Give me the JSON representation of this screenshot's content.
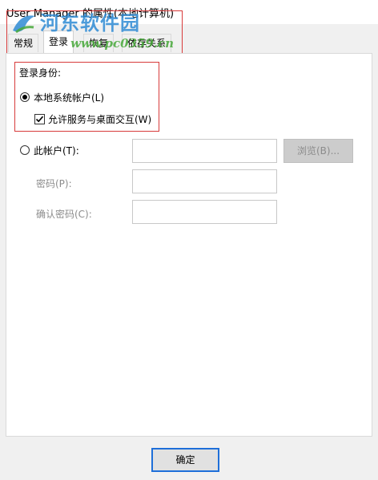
{
  "window": {
    "title": "User Manager 的属性(本地计算机)"
  },
  "watermark": {
    "site_name": "河东软件园",
    "site_url": "www.pc0359.cn"
  },
  "tabs": [
    {
      "label": "常规",
      "active": false
    },
    {
      "label": "登录",
      "active": true
    },
    {
      "label": "恢复",
      "active": false
    },
    {
      "label": "依存关系",
      "active": false
    }
  ],
  "logon": {
    "section_label": "登录身份:",
    "local_system": {
      "label": "本地系统帐户(L)",
      "selected": true
    },
    "allow_interact": {
      "label": "允许服务与桌面交互(W)",
      "checked": true
    },
    "this_account": {
      "label": "此帐户(T):",
      "selected": false,
      "value": ""
    },
    "browse_label": "浏览(B)...",
    "password": {
      "label": "密码(P):",
      "value": ""
    },
    "confirm_password": {
      "label": "确认密码(C):",
      "value": ""
    }
  },
  "footer": {
    "ok_label": "确定"
  },
  "colors": {
    "highlight_box": "#d83b3b",
    "ok_border": "#1e6fd9",
    "watermark_blue": "#2f8bd4",
    "watermark_green": "#48a93a"
  }
}
